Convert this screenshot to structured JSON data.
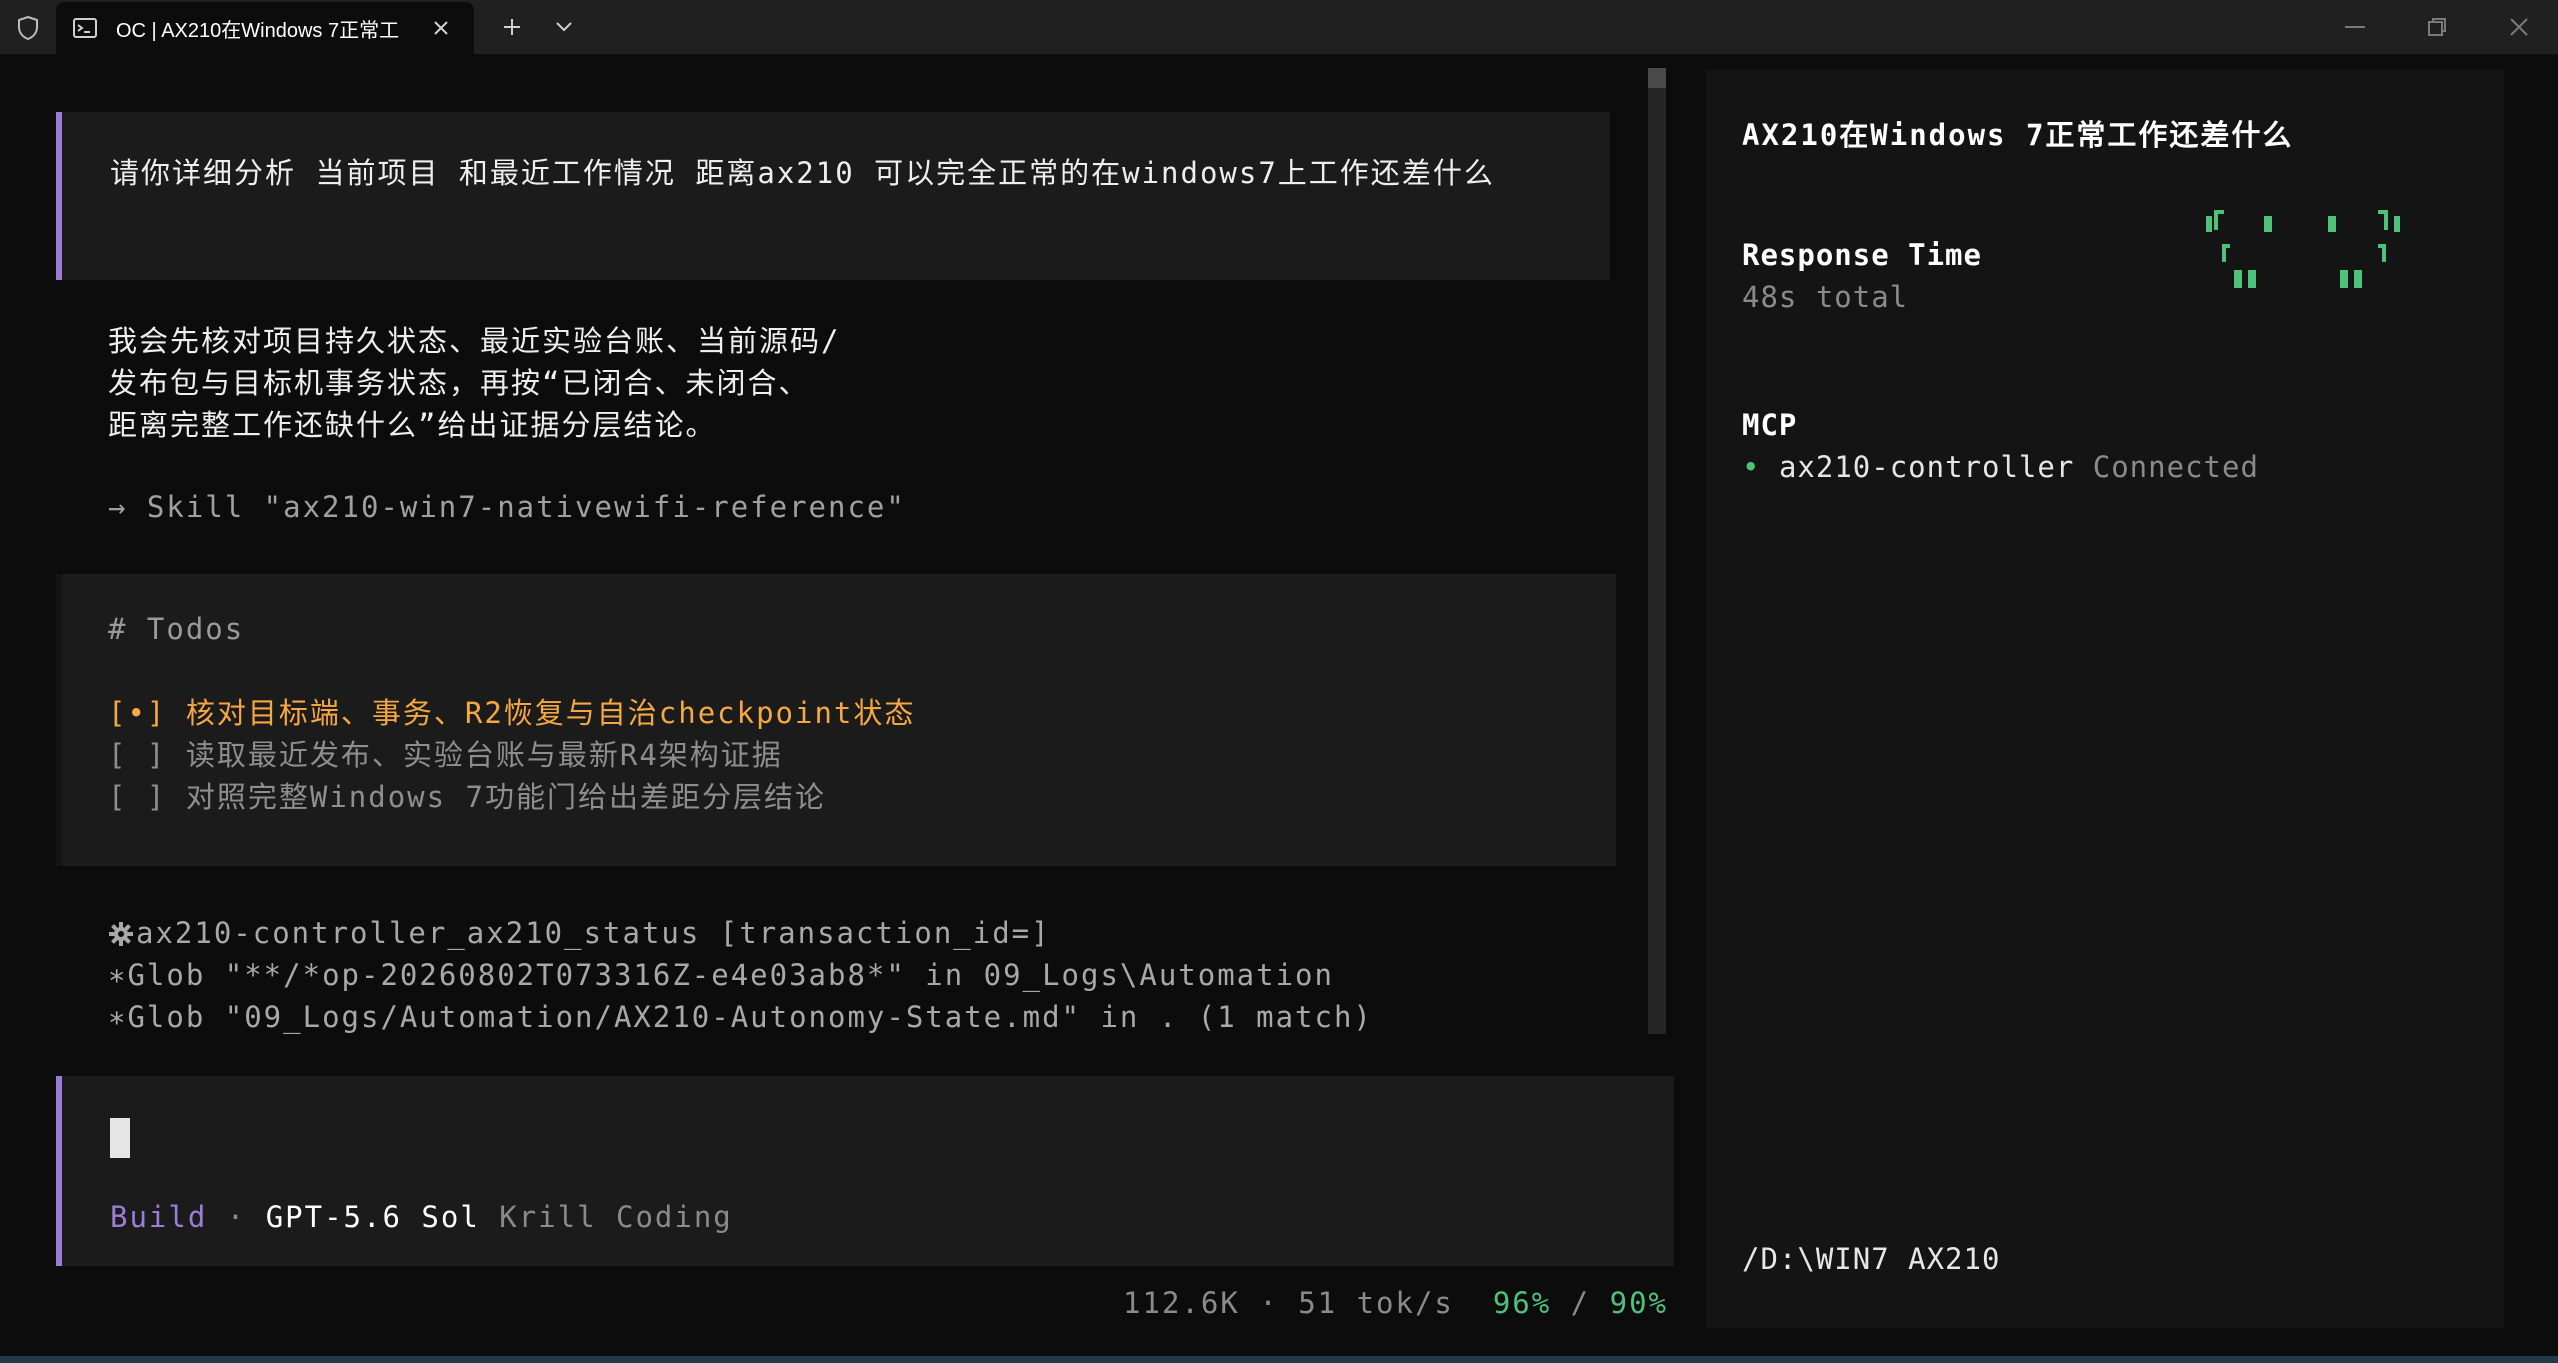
{
  "window": {
    "tab_title": "OC | AX210在Windows 7正常工",
    "colors": {
      "accent_purple": "#9d7cd8",
      "todo_active": "#f5a742",
      "ok_green": "#4ec27a"
    }
  },
  "conversation": {
    "user_message": "请你详细分析 当前项目 和最近工作情况 距离ax210 可以完全正常的在windows7上工作还差什么",
    "assistant_lines": [
      "我会先核对项目持久状态、最近实验台账、当前源码/",
      "发布包与目标机事务状态，再按“已闭合、未闭合、",
      "距离完整工作还缺什么”给出证据分层结论。"
    ],
    "skill_line": "→ Skill \"ax210-win7-nativewifi-reference\"",
    "todos": {
      "heading": "# Todos",
      "items": [
        {
          "mark": "[•]",
          "text": "核对目标端、事务、R2恢复与自治checkpoint状态",
          "state": "in_progress"
        },
        {
          "mark": "[ ]",
          "text": "读取最近发布、实验台账与最新R4架构证据",
          "state": "pending"
        },
        {
          "mark": "[ ]",
          "text": "对照完整Windows 7功能门给出差距分层结论",
          "state": "pending"
        }
      ]
    },
    "tool_calls": [
      {
        "icon": "gear-icon",
        "text": "ax210-controller_ax210_status [transaction_id=]"
      },
      {
        "icon": "asterisk-icon",
        "text": "Glob \"**/*op-20260802T073316Z-e4e03ab8*\" in 09_Logs\\Automation"
      },
      {
        "icon": "asterisk-icon",
        "text": "Glob \"09_Logs/Automation/AX210-Autonomy-State.md\" in . (1 match)"
      }
    ]
  },
  "input": {
    "mode": "Build",
    "separator": "·",
    "model": "GPT-5.6 Sol",
    "provider": "Krill Coding"
  },
  "stats": {
    "tokens": "112.6K",
    "separator": "·",
    "speed": "51 tok/s",
    "usage_a": "96%",
    "slash": "/",
    "usage_b": "90%"
  },
  "sidebar": {
    "title": "AX210在Windows 7正常工作还差什么",
    "response_label": "Response Time",
    "response_value": "48s total",
    "mcp_label": "MCP",
    "mcp_servers": [
      {
        "dot": "•",
        "name": "ax210-controller",
        "status": "Connected"
      }
    ],
    "cwd": "/D:\\WIN7 AX210"
  }
}
